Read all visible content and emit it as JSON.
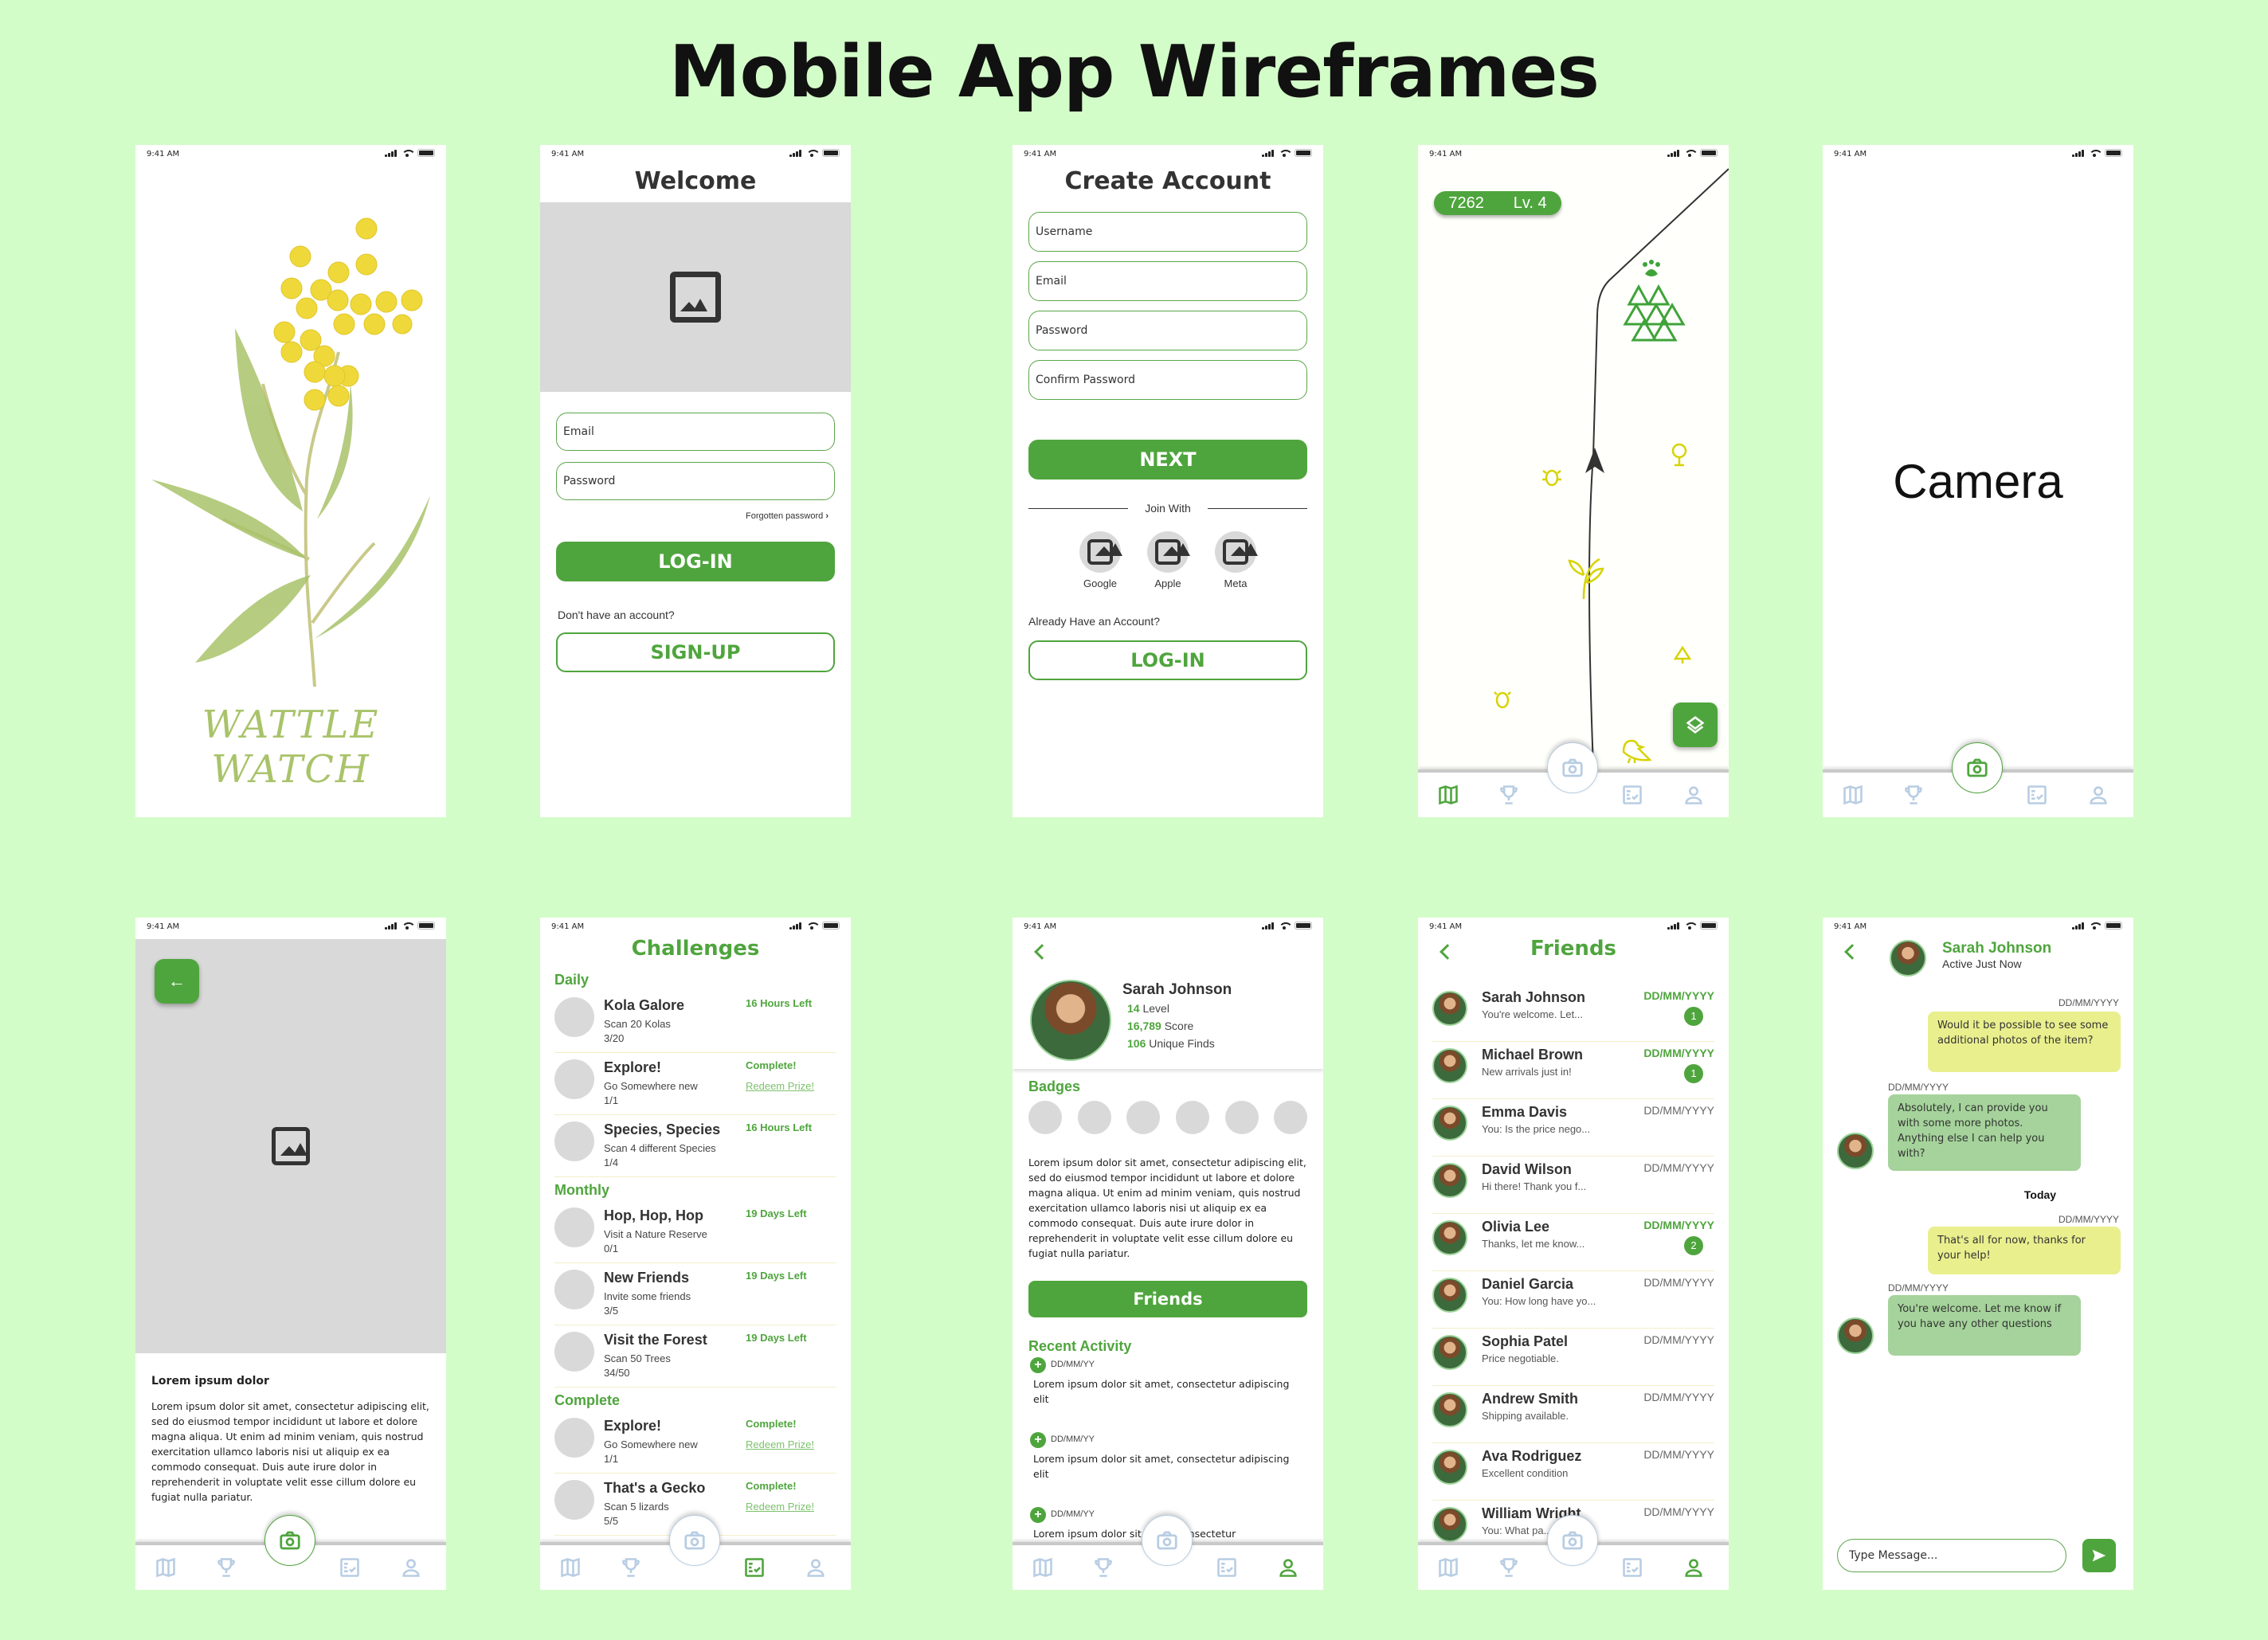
{
  "title": "Mobile App Wireframes",
  "status": {
    "time": "9:41 AM"
  },
  "colors": {
    "background": "#d3fdc8",
    "accent": "#4fa53d",
    "me_bubble": "#e9ef8d",
    "them_bubble": "#a5d39b",
    "nav_inactive": "#b8cde3"
  },
  "splash": {
    "logo_text": "WATTLE WATCH"
  },
  "welcome": {
    "title": "Welcome",
    "email_placeholder": "Email",
    "password_placeholder": "Password",
    "forgot": "Forgotten password",
    "login": "LOG-IN",
    "no_account": "Don't have an account?",
    "signup": "SIGN-UP"
  },
  "create": {
    "title": "Create Account",
    "username_placeholder": "Username",
    "email_placeholder": "Email",
    "password_placeholder": "Password",
    "confirm_placeholder": "Confirm Password",
    "next": "NEXT",
    "join_with": "Join With",
    "providers": [
      "Google",
      "Apple",
      "Meta"
    ],
    "have_account": "Already Have an Account?",
    "login": "LOG-IN"
  },
  "map": {
    "score": "7262",
    "level": "Lv. 4"
  },
  "camera": {
    "label": "Camera"
  },
  "detail": {
    "heading": "Lorem ipsum dolor",
    "body": "Lorem ipsum dolor sit amet, consectetur adipiscing elit, sed do eiusmod tempor incididunt ut labore et dolore magna aliqua. Ut enim ad minim veniam, quis nostrud exercitation ullamco laboris nisi ut aliquip ex ea commodo consequat. Duis aute irure dolor in reprehenderit in voluptate velit esse cillum dolore eu fugiat nulla pariatur."
  },
  "challenges": {
    "title": "Challenges",
    "sections": [
      {
        "name": "Daily",
        "items": [
          {
            "title": "Kola Galore",
            "desc": "Scan 20 Kolas",
            "progress": "3/20",
            "status": "16 Hours Left",
            "link": ""
          },
          {
            "title": "Explore!",
            "desc": "Go Somewhere new",
            "progress": "1/1",
            "status": "Complete!",
            "link": "Redeem Prize!"
          },
          {
            "title": "Species, Species",
            "desc": "Scan 4 different Species",
            "progress": "1/4",
            "status": "16 Hours Left",
            "link": ""
          }
        ]
      },
      {
        "name": "Monthly",
        "items": [
          {
            "title": "Hop, Hop, Hop",
            "desc": "Visit a Nature Reserve",
            "progress": "0/1",
            "status": "19 Days Left",
            "link": ""
          },
          {
            "title": "New Friends",
            "desc": "Invite some friends",
            "progress": "3/5",
            "status": "19 Days Left",
            "link": ""
          },
          {
            "title": "Visit the Forest",
            "desc": "Scan 50 Trees",
            "progress": "34/50",
            "status": "19 Days Left",
            "link": ""
          }
        ]
      },
      {
        "name": "Complete",
        "items": [
          {
            "title": "Explore!",
            "desc": "Go Somewhere new",
            "progress": "1/1",
            "status": "Complete!",
            "link": "Redeem Prize!"
          },
          {
            "title": "That's a Gecko",
            "desc": "Scan 5 lizards",
            "progress": "5/5",
            "status": "Complete!",
            "link": "Redeem Prize!"
          }
        ]
      }
    ]
  },
  "profile": {
    "name": "Sarah Johnson",
    "level_value": "14",
    "level_label": "Level",
    "score_value": "16,789",
    "score_label": "Score",
    "finds_value": "106",
    "finds_label": "Unique Finds",
    "badges_label": "Badges",
    "bio": "Lorem ipsum dolor sit amet, consectetur adipiscing elit, sed do eiusmod tempor incididunt ut labore et dolore magna aliqua. Ut enim ad minim veniam, quis nostrud exercitation ullamco laboris nisi ut aliquip ex ea commodo consequat. Duis aute irure dolor in reprehenderit in voluptate velit esse cillum dolore eu fugiat nulla pariatur.",
    "friends_button": "Friends",
    "recent_label": "Recent Activity",
    "activity": [
      {
        "date": "DD/MM/YY",
        "text": "Lorem ipsum dolor sit amet, consectetur adipiscing elit"
      },
      {
        "date": "DD/MM/YY",
        "text": "Lorem ipsum dolor sit amet, consectetur adipiscing elit"
      },
      {
        "date": "DD/MM/YY",
        "text": "Lorem ipsum dolor sit amet, consectetur"
      }
    ]
  },
  "friends": {
    "title": "Friends",
    "list": [
      {
        "name": "Sarah Johnson",
        "msg": "You're welcome. Let...",
        "date": "DD/MM/YYYY",
        "unread": "1"
      },
      {
        "name": "Michael Brown",
        "msg": "New arrivals just in!",
        "date": "DD/MM/YYYY",
        "unread": "1"
      },
      {
        "name": "Emma Davis",
        "msg": "You: Is the price nego...",
        "date": "DD/MM/YYYY",
        "unread": ""
      },
      {
        "name": "David Wilson",
        "msg": "Hi there! Thank you f...",
        "date": "DD/MM/YYYY",
        "unread": ""
      },
      {
        "name": "Olivia Lee",
        "msg": "Thanks, let me know...",
        "date": "DD/MM/YYYY",
        "unread": "2"
      },
      {
        "name": "Daniel Garcia",
        "msg": "You: How long have yo...",
        "date": "DD/MM/YYYY",
        "unread": ""
      },
      {
        "name": "Sophia Patel",
        "msg": "Price negotiable.",
        "date": "DD/MM/YYYY",
        "unread": ""
      },
      {
        "name": "Andrew Smith",
        "msg": "Shipping available.",
        "date": "DD/MM/YYYY",
        "unread": ""
      },
      {
        "name": "Ava Rodriguez",
        "msg": "Excellent condition",
        "date": "DD/MM/YYYY",
        "unread": ""
      },
      {
        "name": "William Wright",
        "msg": "You: What pa...",
        "date": "DD/MM/YYYY",
        "unread": ""
      }
    ]
  },
  "chat": {
    "name": "Sarah Johnson",
    "presence": "Active Just Now",
    "today": "Today",
    "messages": [
      {
        "from": "me",
        "date": "DD/MM/YYYY",
        "text": "Would it be possible to see some additional photos of the item?"
      },
      {
        "from": "them",
        "date": "DD/MM/YYYY",
        "text": "Absolutely, I can provide you with some more photos. Anything else I can help you with?"
      },
      {
        "from": "me",
        "date": "DD/MM/YYYY",
        "text": "That's all for now, thanks for your help!"
      },
      {
        "from": "them",
        "date": "DD/MM/YYYY",
        "text": "You're welcome. Let me know if you have any other questions"
      }
    ],
    "input_placeholder": "Type Message..."
  }
}
